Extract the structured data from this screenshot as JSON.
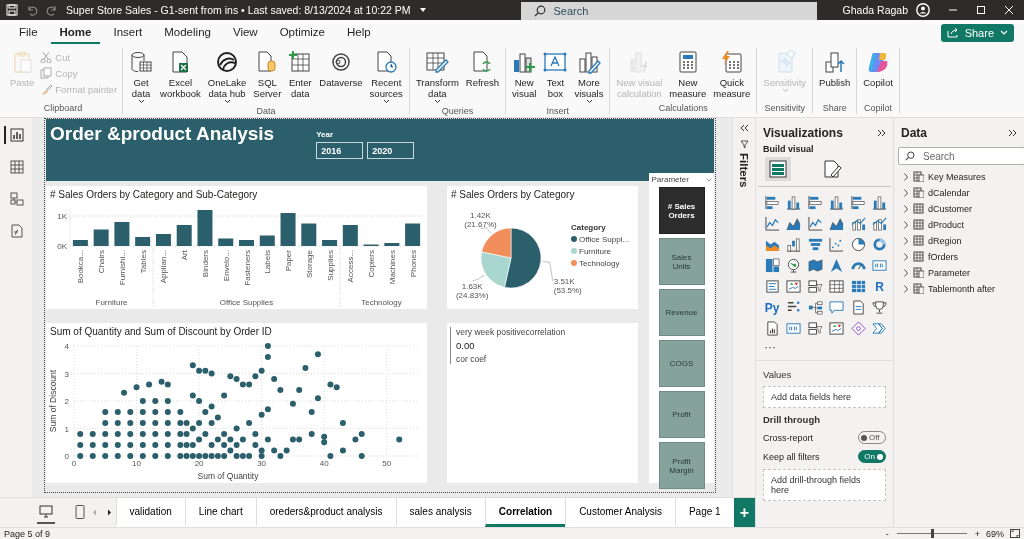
{
  "title_bar": {
    "title": "Super Store Sales - G1-sent from ins • Last saved: 8/13/2024 at 10:22 PM",
    "search": {
      "placeholder": "Search"
    },
    "user": "Ghada Ragab"
  },
  "menu_tabs": [
    {
      "label": "File",
      "selected": false
    },
    {
      "label": "Home",
      "selected": true
    },
    {
      "label": "Insert",
      "selected": false
    },
    {
      "label": "Modeling",
      "selected": false
    },
    {
      "label": "View",
      "selected": false
    },
    {
      "label": "Optimize",
      "selected": false
    },
    {
      "label": "Help",
      "selected": false
    }
  ],
  "share_button": {
    "label": "Share"
  },
  "ribbon": [
    {
      "label": "Clipboard",
      "items": [
        {
          "kind": "large",
          "label": "Paste",
          "disabled": true,
          "dropdown": false
        },
        {
          "kind": "small",
          "label": "Cut",
          "disabled": true,
          "dropdown": false
        },
        {
          "kind": "small",
          "label": "Copy",
          "disabled": true,
          "dropdown": false
        },
        {
          "kind": "small",
          "label": "Format painter",
          "disabled": true,
          "dropdown": false
        }
      ]
    },
    {
      "label": "Data",
      "items": [
        {
          "kind": "large",
          "label": "Get\ndata",
          "disabled": false,
          "dropdown": true
        },
        {
          "kind": "large",
          "label": "Excel\nworkbook",
          "disabled": false,
          "dropdown": false
        },
        {
          "kind": "large",
          "label": "OneLake\ndata hub",
          "disabled": false,
          "dropdown": true
        },
        {
          "kind": "large",
          "label": "SQL\nServer",
          "disabled": false,
          "dropdown": false
        },
        {
          "kind": "large",
          "label": "Enter\ndata",
          "disabled": false,
          "dropdown": false
        },
        {
          "kind": "large",
          "label": "Dataverse",
          "disabled": false,
          "dropdown": false
        },
        {
          "kind": "large",
          "label": "Recent\nsources",
          "disabled": false,
          "dropdown": true
        }
      ]
    },
    {
      "label": "Queries",
      "items": [
        {
          "kind": "large",
          "label": "Transform\ndata",
          "disabled": false,
          "dropdown": true
        },
        {
          "kind": "large",
          "label": "Refresh",
          "disabled": false,
          "dropdown": false
        }
      ]
    },
    {
      "label": "Insert",
      "items": [
        {
          "kind": "large",
          "label": "New\nvisual",
          "disabled": false,
          "dropdown": false
        },
        {
          "kind": "large",
          "label": "Text\nbox",
          "disabled": false,
          "dropdown": false
        },
        {
          "kind": "large",
          "label": "More\nvisuals",
          "disabled": false,
          "dropdown": true
        }
      ]
    },
    {
      "label": "Calculations",
      "items": [
        {
          "kind": "large",
          "label": "New visual\ncalculation",
          "disabled": true,
          "dropdown": false
        },
        {
          "kind": "large",
          "label": "New\nmeasure",
          "disabled": false,
          "dropdown": false
        },
        {
          "kind": "large",
          "label": "Quick\nmeasure",
          "disabled": false,
          "dropdown": false
        }
      ]
    },
    {
      "label": "Sensitivity",
      "items": [
        {
          "kind": "large",
          "label": "Sensitivity",
          "disabled": true,
          "dropdown": true
        }
      ]
    },
    {
      "label": "Share",
      "items": [
        {
          "kind": "large",
          "label": "Publish",
          "disabled": false,
          "dropdown": false
        }
      ]
    },
    {
      "label": "Copilot",
      "items": [
        {
          "kind": "large",
          "label": "Copilot",
          "disabled": false,
          "dropdown": false
        }
      ]
    }
  ],
  "left_rail": [
    {
      "selected": true
    },
    {
      "selected": false
    },
    {
      "selected": false
    },
    {
      "selected": false
    }
  ],
  "report": {
    "title": "Order &product Analysis",
    "year_slicer": {
      "label": "Year",
      "from": "2016",
      "to": "2020"
    },
    "bar_card": {
      "chart_data": {
        "type": "bar",
        "title": "# Sales Orders by Category and Sub-Category",
        "categories": [
          "Bookca...",
          "Chairs",
          "Furnishi...",
          "Tables",
          "Applian...",
          "Art",
          "Binders",
          "Envelo...",
          "Fasteners",
          "Labels",
          "Paper",
          "Storage",
          "Supplies",
          "Access...",
          "Copiers",
          "Machines",
          "Phones"
        ],
        "series": [
          {
            "color": "#2b5f6b",
            "values": [
              200,
              550,
              800,
              300,
              400,
              700,
              1200,
              250,
              200,
              350,
              1100,
              750,
              200,
              700,
              50,
              100,
              750
            ]
          }
        ],
        "annotations": [
          "Furniture",
          "Office Supplies",
          "Technology"
        ],
        "ylim": [
          0,
          1250
        ],
        "yticks": [
          {
            "value": 0,
            "label": "0K"
          },
          {
            "value": 1000,
            "label": "1K"
          }
        ]
      }
    },
    "pie_card": {
      "chart_data": {
        "type": "pie",
        "title": "# Sales Orders by Category",
        "legend_title": "Category",
        "categories": [
          "Office Suppl...",
          "Furniture",
          "Technology"
        ],
        "series": [
          {
            "values": [
              53.5,
              24.83,
              21.67
            ]
          }
        ],
        "legend": "right",
        "colors": [
          "#2b5f6b",
          "#a9d6cf",
          "#f28e5c"
        ],
        "value_labels": [
          "3.51K (53.5%)",
          "1.63K (24.83%)",
          "1.42K (21.67%)"
        ]
      }
    },
    "scatter_card": {
      "chart_data": {
        "type": "scatter",
        "title": "Sum of Quantity and Sum of Discount by Order ID",
        "xlabel": "Sum of Quantity",
        "ylabel": "Sum of Discount",
        "xlim": [
          0,
          55
        ],
        "ylim": [
          0,
          4
        ],
        "grid": true,
        "xticks": [
          0,
          10,
          20,
          30,
          40,
          50
        ],
        "yticks": [
          0,
          1,
          2,
          3,
          4
        ],
        "x": [
          1,
          1,
          1,
          3,
          3,
          3,
          5,
          5,
          5,
          5,
          5,
          7,
          7,
          7,
          7,
          7,
          9,
          9,
          9,
          9,
          9,
          11,
          11,
          11,
          11,
          11,
          11,
          13,
          13,
          13,
          13,
          13,
          13,
          15,
          15,
          15,
          15,
          15,
          15,
          8,
          10,
          12,
          14,
          15,
          17,
          18,
          19,
          20,
          21,
          22,
          19,
          20,
          21,
          22,
          23,
          24,
          25,
          26,
          27,
          28,
          29,
          30,
          31,
          31,
          32,
          33,
          35,
          36,
          37,
          38,
          39,
          39,
          40,
          41,
          42,
          43,
          45,
          46,
          52,
          20,
          22,
          24,
          25,
          27,
          28,
          29,
          30,
          31,
          32,
          33,
          34,
          35,
          36,
          41,
          43,
          46,
          18,
          17,
          19,
          23,
          26,
          30,
          31,
          38,
          40,
          17,
          17,
          17,
          18,
          18,
          19,
          19,
          20,
          20,
          21,
          21,
          22,
          22,
          23,
          24,
          24,
          25,
          26,
          26,
          27,
          28,
          29,
          30
        ],
        "series": [
          {
            "color": "#2b5f6b",
            "values": [
              0,
              0.4,
              0.8,
              0,
              0.4,
              0.8,
              0,
              0.4,
              0.8,
              1.2,
              1.6,
              0,
              0.4,
              0.8,
              1.2,
              1.6,
              0,
              0.4,
              0.8,
              1.2,
              1.6,
              0,
              0.4,
              0.8,
              1.2,
              1.6,
              2,
              0,
              0.4,
              0.8,
              1.2,
              1.6,
              2,
              0,
              0.4,
              0.8,
              1.2,
              1.6,
              2,
              2.3,
              2.5,
              2.6,
              2.7,
              2.6,
              1.6,
              1.2,
              3.3,
              3.1,
              3.1,
              3,
              2.2,
              2,
              1.6,
              1.8,
              1.4,
              2.2,
              2.9,
              2.8,
              2.6,
              2.6,
              2.9,
              3.1,
              3.6,
              4,
              2.8,
              2.4,
              1.9,
              2.4,
              3.2,
              1.6,
              3.7,
              2.1,
              0.7,
              2.6,
              2.5,
              1.2,
              0.6,
              0.8,
              0.6,
              0.6,
              0.4,
              0.8,
              0.2,
              0.6,
              1.2,
              0.4,
              0.2,
              0.6,
              0.2,
              0,
              0.2,
              0.6,
              0.6,
              0,
              0.2,
              0,
              0.4,
              0.8,
              1,
              0.6,
              1,
              1.5,
              1.7,
              0.8,
              0.5,
              0,
              0.4,
              1.2,
              0,
              0.8,
              0,
              0.4,
              0,
              1.2,
              0,
              0.8,
              0,
              1.2,
              0,
              0,
              0.4,
              0.6,
              0,
              0.4,
              0,
              0,
              0.8,
              0
            ]
          }
        ]
      }
    },
    "correlation_card": {
      "lines": [
        "very week positivecorrelation",
        "0.00",
        "cor coef"
      ]
    },
    "parameter_slicer": {
      "title": "Parameter",
      "options": [
        {
          "label": "# Sales Orders",
          "selected": true
        },
        {
          "label": "Sales Units",
          "selected": false
        },
        {
          "label": "Revenue",
          "selected": false
        },
        {
          "label": "COGS",
          "selected": false
        },
        {
          "label": "Profit",
          "selected": false
        },
        {
          "label": "Profit Margin",
          "selected": false
        }
      ]
    }
  },
  "filters_pane": {
    "label": "Filters"
  },
  "visualizations": {
    "title": "Visualizations",
    "subtitle": "Build visual",
    "tabs": [
      {
        "selected": true
      },
      {
        "selected": false
      }
    ],
    "script_labels": [
      "R",
      "Py"
    ],
    "more": "···",
    "values_label": "Values",
    "values_placeholder": "Add data fields here",
    "drill_label": "Drill through",
    "toggles": [
      {
        "label": "Cross-report",
        "text": "Off",
        "on": false
      },
      {
        "label": "Keep all filters",
        "text": "On",
        "on": true
      }
    ],
    "drill_placeholder": "Add drill-through fields here"
  },
  "data_pane": {
    "title": "Data",
    "search": {
      "placeholder": "Search"
    },
    "tables": [
      {
        "label": "Key Measures",
        "kind": "measure_table",
        "expanded": false
      },
      {
        "label": "dCalendar",
        "kind": "measure_table",
        "expanded": false
      },
      {
        "label": "dCustomer",
        "kind": "table",
        "expanded": false
      },
      {
        "label": "dProduct",
        "kind": "table",
        "expanded": false
      },
      {
        "label": "dRegion",
        "kind": "table",
        "expanded": false
      },
      {
        "label": "fOrders",
        "kind": "table",
        "expanded": false
      },
      {
        "label": "Parameter",
        "kind": "measure_table",
        "expanded": false
      },
      {
        "label": "Tablemonth after",
        "kind": "measure_table",
        "expanded": false
      }
    ]
  },
  "page_tabs": {
    "views": [
      {
        "selected": true
      },
      {
        "selected": false
      }
    ],
    "tabs": [
      {
        "label": "validation",
        "selected": false
      },
      {
        "label": "Line chart",
        "selected": false
      },
      {
        "label": "oreders&product analysis",
        "selected": false
      },
      {
        "label": "sales analysis",
        "selected": false
      },
      {
        "label": "Correlation",
        "selected": true
      },
      {
        "label": "Customer Analysis",
        "selected": false
      },
      {
        "label": "Page 1",
        "selected": false
      }
    ],
    "add_page": "+"
  },
  "status_bar": {
    "page": "Page 5 of 9",
    "zoom": {
      "minus": "-",
      "plus": "+",
      "level": 0.5,
      "reading": "69%"
    }
  }
}
